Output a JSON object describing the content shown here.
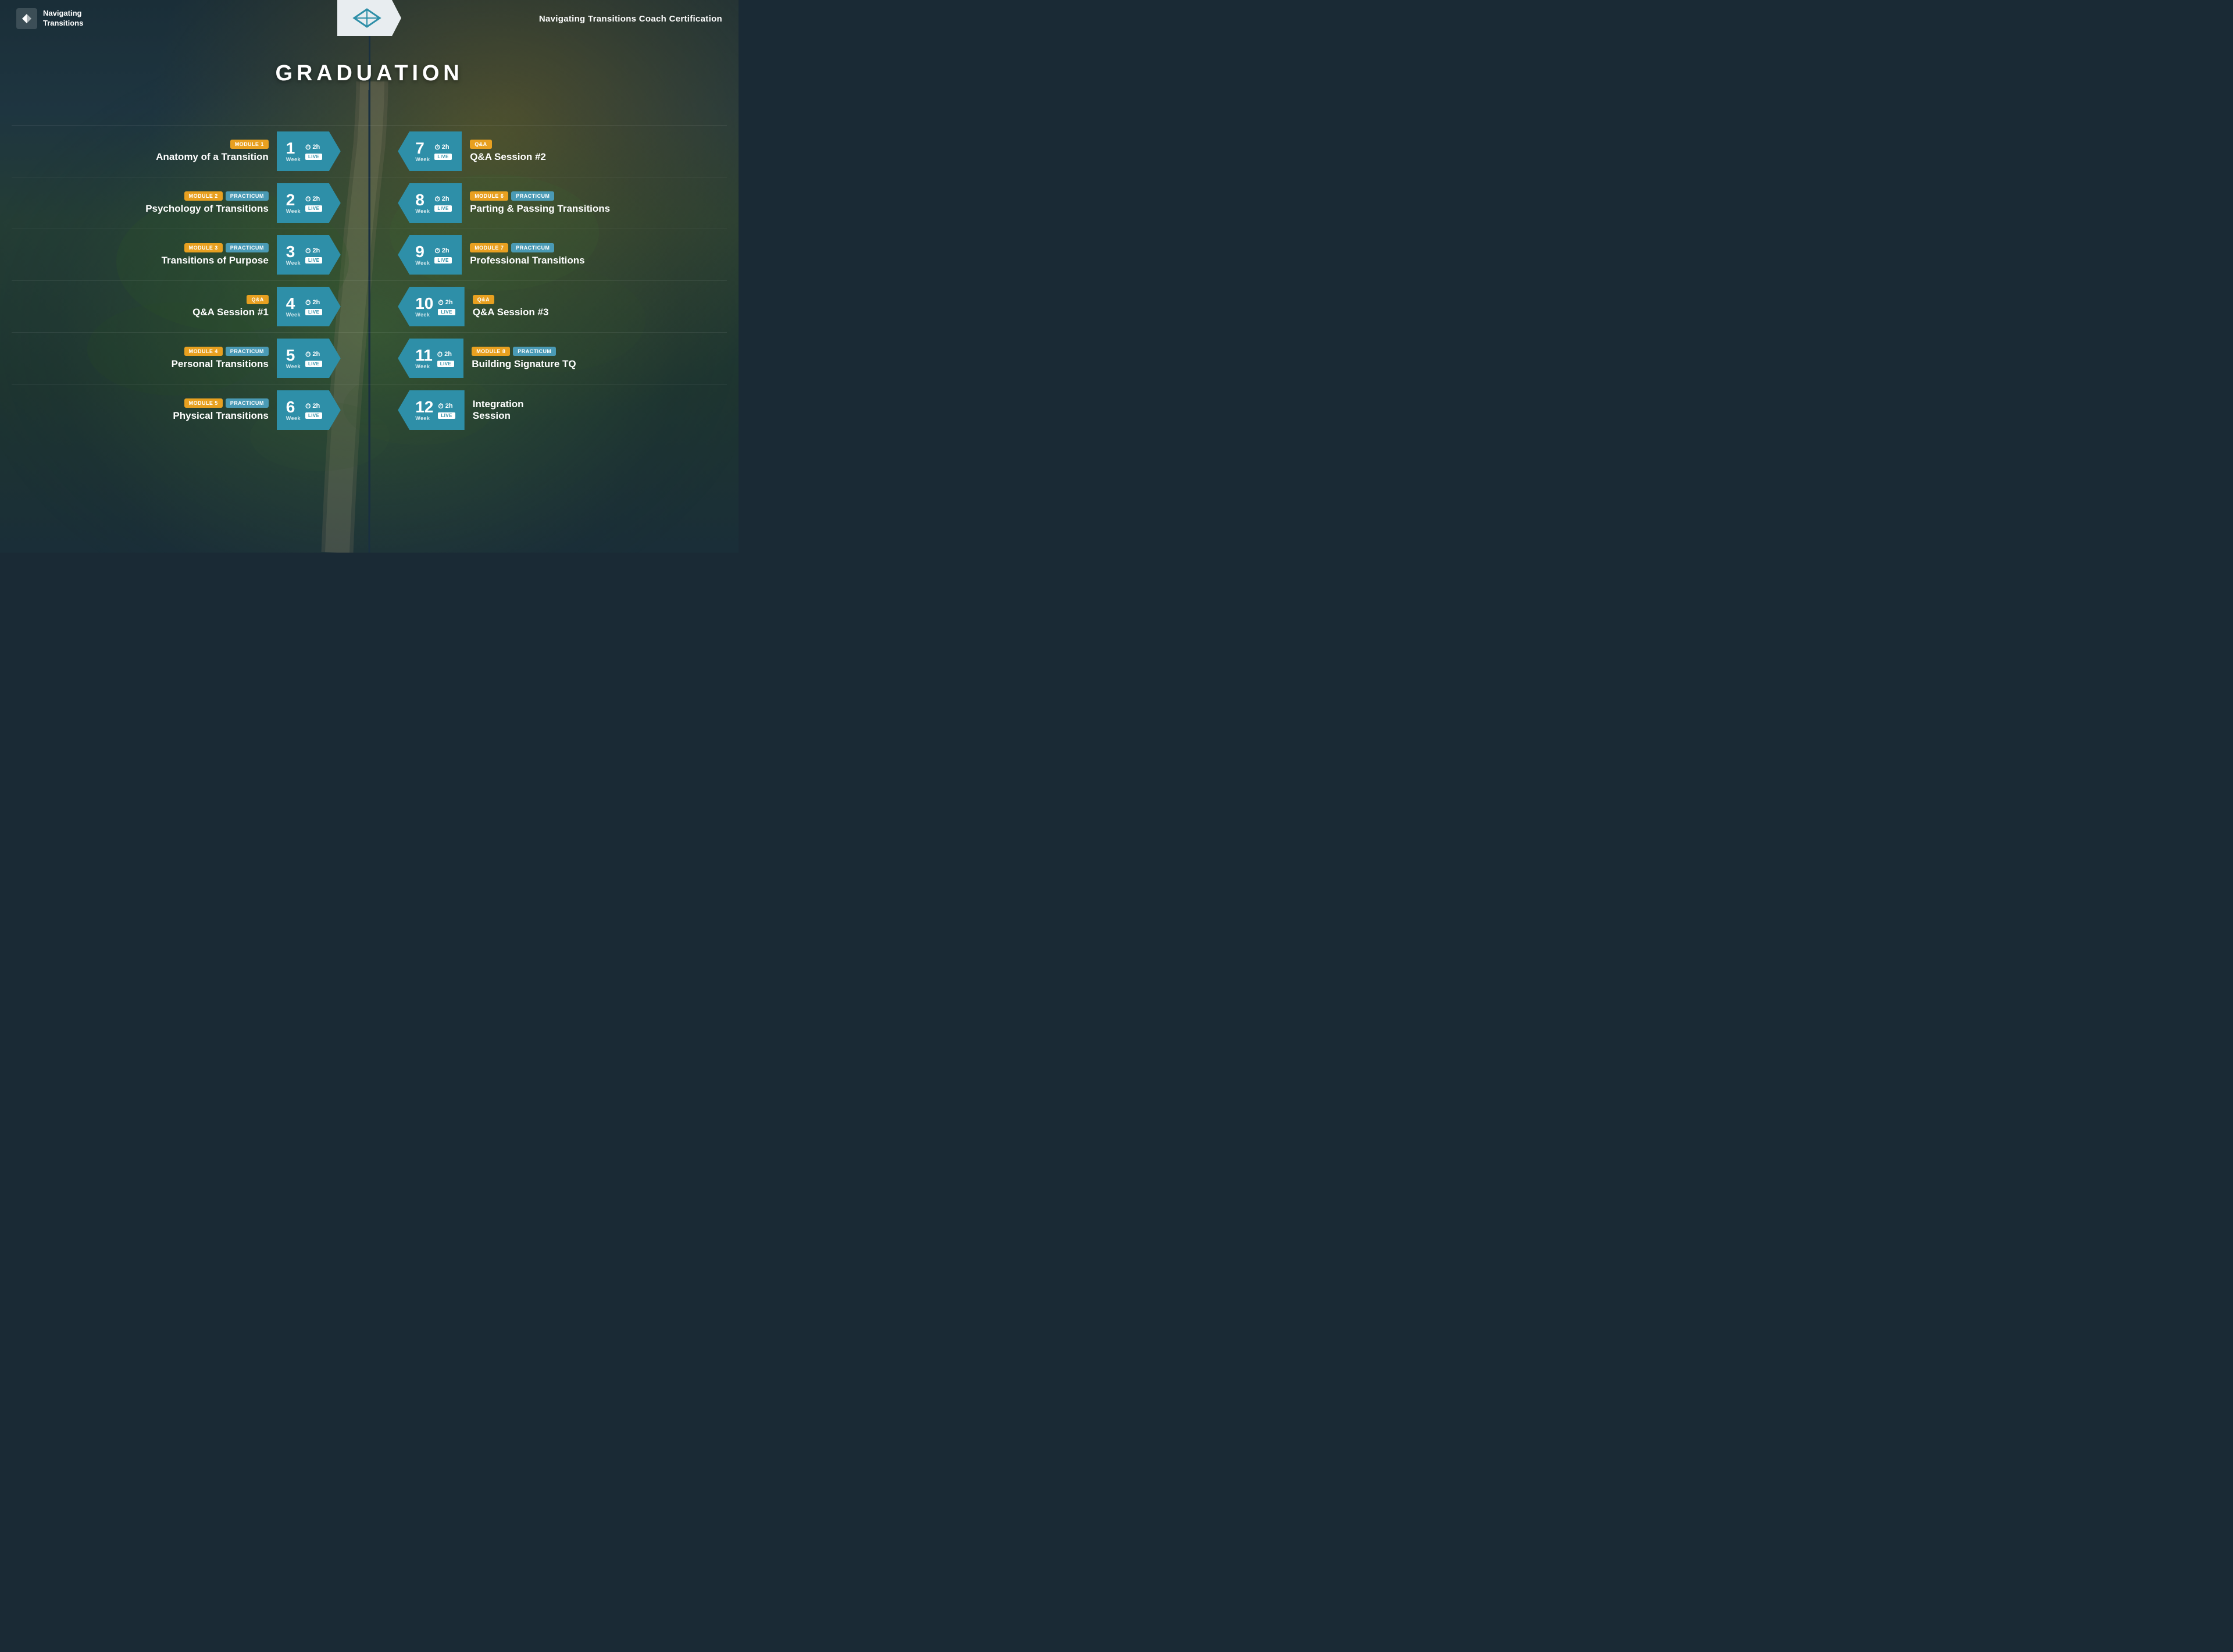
{
  "header": {
    "logo_text_line1": "Navigating",
    "logo_text_line2": "Transitions",
    "title": "Navigating Transitions Coach Certification"
  },
  "graduation": {
    "label": "GRADUATION"
  },
  "left_rows": [
    {
      "badges": [
        {
          "type": "module",
          "label": "MODULE 1"
        }
      ],
      "title": "Anatomy of a Transition",
      "week": "1",
      "time": "2h",
      "live": "LIVE"
    },
    {
      "badges": [
        {
          "type": "module",
          "label": "MODULE 2"
        },
        {
          "type": "practicum",
          "label": "PRACTICUM"
        }
      ],
      "title": "Psychology of Transitions",
      "week": "2",
      "time": "2h",
      "live": "LIVE"
    },
    {
      "badges": [
        {
          "type": "module",
          "label": "MODULE 3"
        },
        {
          "type": "practicum",
          "label": "PRACTICUM"
        }
      ],
      "title": "Transitions of Purpose",
      "week": "3",
      "time": "2h",
      "live": "LIVE"
    },
    {
      "badges": [
        {
          "type": "qa",
          "label": "Q&A"
        }
      ],
      "title": "Q&A Session #1",
      "week": "4",
      "time": "2h",
      "live": "LIVE"
    },
    {
      "badges": [
        {
          "type": "module",
          "label": "MODULE 4"
        },
        {
          "type": "practicum",
          "label": "PRACTICUM"
        }
      ],
      "title": "Personal Transitions",
      "week": "5",
      "time": "2h",
      "live": "LIVE"
    },
    {
      "badges": [
        {
          "type": "module",
          "label": "MODULE 5"
        },
        {
          "type": "practicum",
          "label": "PRACTICUM"
        }
      ],
      "title": "Physical Transitions",
      "week": "6",
      "time": "2h",
      "live": "LIVE"
    }
  ],
  "right_rows": [
    {
      "badges": [
        {
          "type": "qa",
          "label": "Q&A"
        }
      ],
      "title": "Q&A Session #2",
      "week": "7",
      "time": "2h",
      "live": "LIVE"
    },
    {
      "badges": [
        {
          "type": "module",
          "label": "MODULE 6"
        },
        {
          "type": "practicum",
          "label": "PRACTICUM"
        }
      ],
      "title": "Parting & Passing Transitions",
      "week": "8",
      "time": "2h",
      "live": "LIVE"
    },
    {
      "badges": [
        {
          "type": "module",
          "label": "MODULE 7"
        },
        {
          "type": "practicum",
          "label": "PRACTICUM"
        }
      ],
      "title": "Professional Transitions",
      "week": "9",
      "time": "2h",
      "live": "LIVE"
    },
    {
      "badges": [
        {
          "type": "qa",
          "label": "Q&A"
        }
      ],
      "title": "Q&A Session #3",
      "week": "10",
      "time": "2h",
      "live": "LIVE"
    },
    {
      "badges": [
        {
          "type": "module",
          "label": "MODULE 8"
        },
        {
          "type": "practicum",
          "label": "PRACTICUM"
        }
      ],
      "title": "Building Signature TQ",
      "week": "11",
      "time": "2h",
      "live": "LIVE"
    },
    {
      "badges": [],
      "title": "Integration\nSession",
      "week": "12",
      "time": "2h",
      "live": "LIVE"
    }
  ]
}
